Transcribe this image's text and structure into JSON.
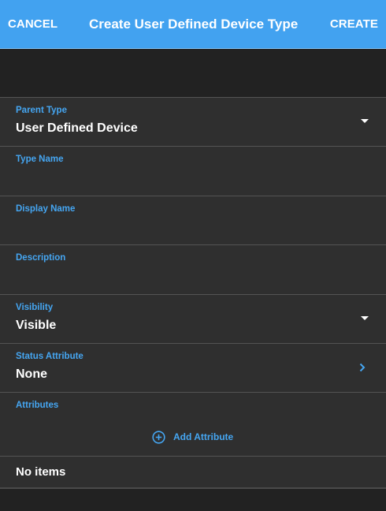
{
  "header": {
    "cancel_label": "CANCEL",
    "title": "Create User Defined Device Type",
    "create_label": "CREATE",
    "background": "#42a2f0"
  },
  "form": {
    "parent_type": {
      "label": "Parent Type",
      "value": "User Defined Device",
      "icon": "dropdown-caret-icon"
    },
    "type_name": {
      "label": "Type Name",
      "value": ""
    },
    "display_name": {
      "label": "Display Name",
      "value": ""
    },
    "description": {
      "label": "Description",
      "value": ""
    },
    "visibility": {
      "label": "Visibility",
      "value": "Visible",
      "icon": "dropdown-caret-icon"
    },
    "status_attribute": {
      "label": "Status Attribute",
      "value": "None",
      "icon": "chevron-right-icon"
    },
    "attributes": {
      "label": "Attributes",
      "add_label": "Add Attribute",
      "add_icon": "add-circle-icon",
      "empty_text": "No items"
    }
  },
  "colors": {
    "accent": "#45a6f2",
    "surface": "#2f2f2f",
    "dark": "#222222",
    "divider": "#545454"
  }
}
